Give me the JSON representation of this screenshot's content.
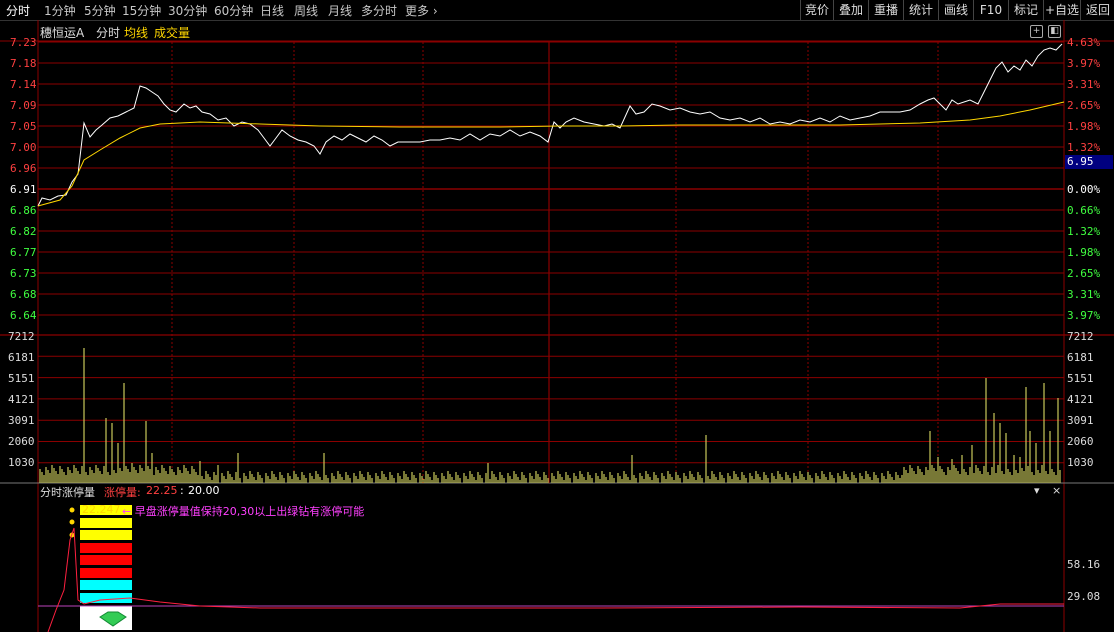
{
  "toolbar": {
    "timeframes": [
      "分时",
      "1分钟",
      "5分钟",
      "15分钟",
      "30分钟",
      "60分钟",
      "日线",
      "周线",
      "月线",
      "多分时",
      "更多 ›"
    ],
    "buttons": [
      "竞价",
      "叠加",
      "重播",
      "统计",
      "画线",
      "F10",
      "标记",
      "+自选",
      "返回"
    ]
  },
  "header": {
    "stock_name": "穗恒运A",
    "view_label": "分时",
    "avg_label": "均线",
    "vol_label": "成交量"
  },
  "price_axis": {
    "left": [
      "7.23",
      "7.18",
      "7.14",
      "7.09",
      "7.05",
      "7.00",
      "6.96",
      "6.91",
      "6.86",
      "6.82",
      "6.77",
      "6.73",
      "6.68",
      "6.64"
    ],
    "right": [
      "4.63%",
      "3.97%",
      "3.31%",
      "2.65%",
      "1.98%",
      "1.32%",
      "",
      "0.00%",
      "0.66%",
      "1.32%",
      "1.98%",
      "2.65%",
      "3.31%",
      "3.97%"
    ],
    "current_price_tag": "6.95"
  },
  "volume_axis": {
    "left": [
      "7212",
      "6181",
      "5151",
      "4121",
      "3091",
      "2060",
      "1030"
    ],
    "right": [
      "7212",
      "6181",
      "5151",
      "4121",
      "3091",
      "2060",
      "1030"
    ]
  },
  "indicator": {
    "title": "分时涨停量",
    "param_label": "涨停量:",
    "param_value1": "22.25",
    "param_value2": "20.00",
    "value_label": "22.247",
    "annotation": "← 早盘涨停量值保持20,30以上出绿钻有涨停可能",
    "axis_labels": [
      "58.16",
      "29.08"
    ],
    "controls": [
      "▾",
      "×"
    ]
  },
  "colors": {
    "grid": "#8b0000",
    "price_line": "#ffffff",
    "avg_line": "#ffd700",
    "volume_bar": "#c8c85a",
    "up_text": "#ff4040",
    "down_text": "#40ff40",
    "tag_bg": "#000080",
    "magenta": "#ff40ff"
  }
}
